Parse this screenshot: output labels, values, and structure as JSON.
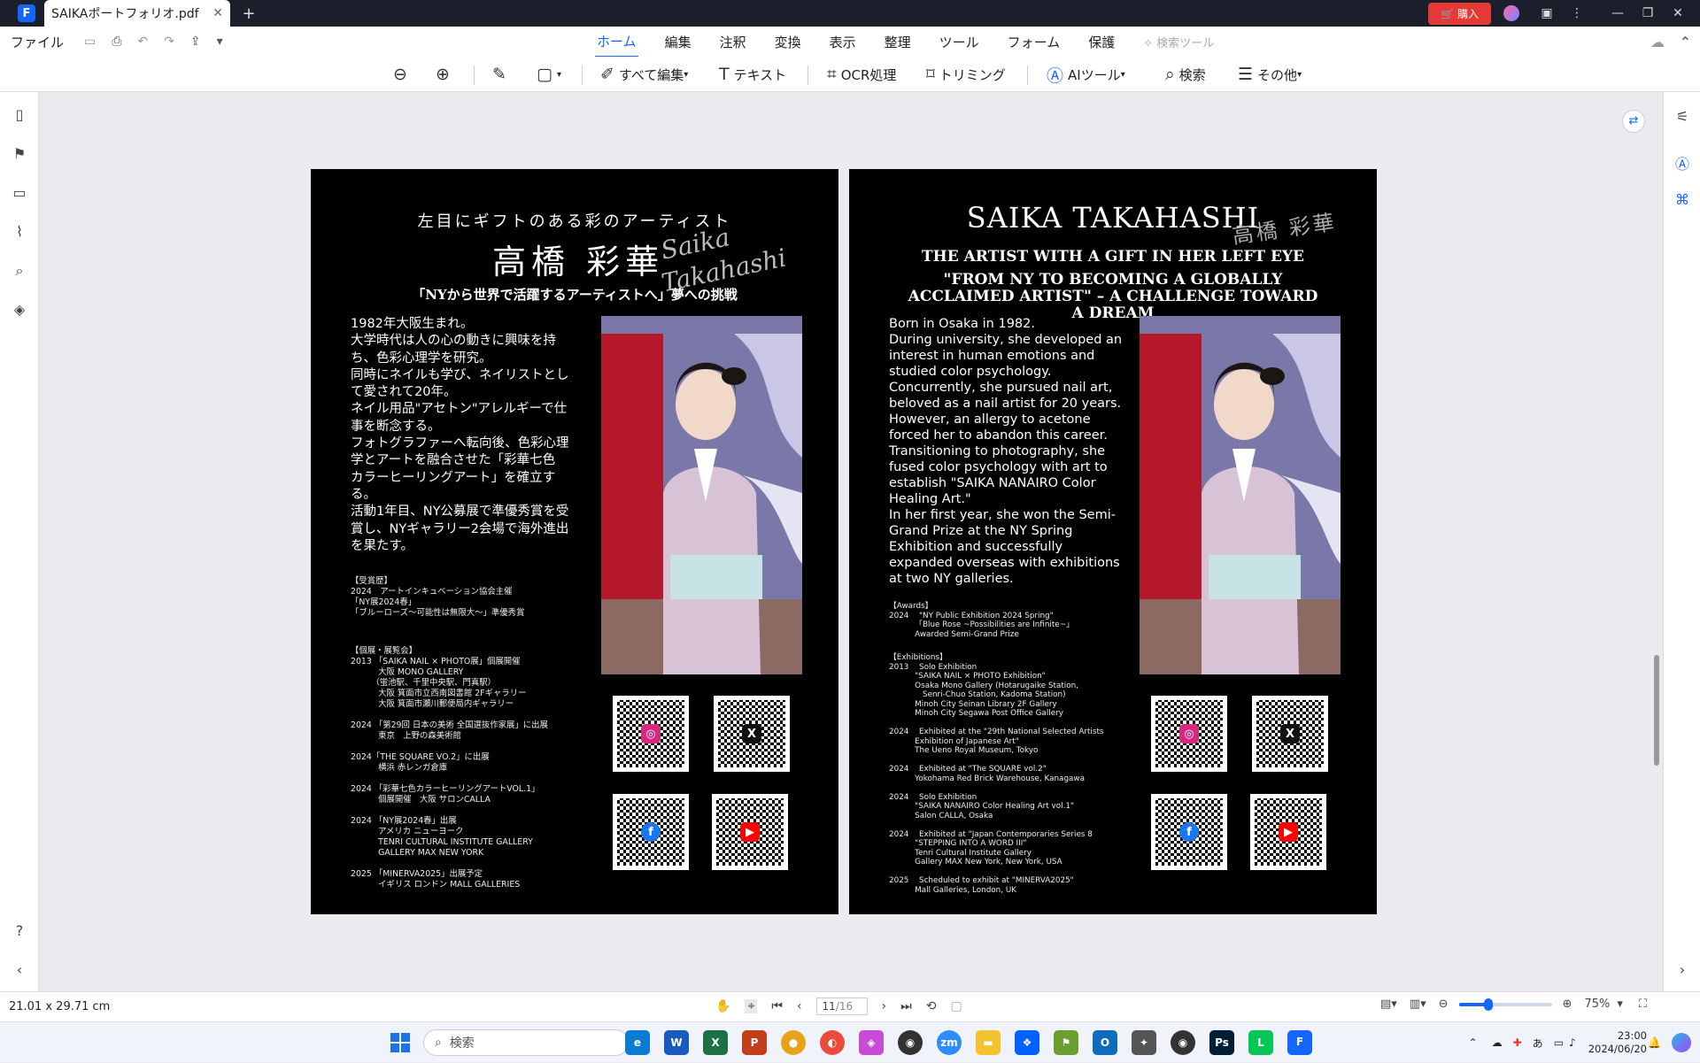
{
  "titlebar": {
    "logo": "F",
    "tab_title": "SAIKAポートフォリオ.pdf",
    "close": "✕",
    "new_tab": "+",
    "buy_label": "購入"
  },
  "menubar": {
    "file": "ファイル",
    "menus": [
      "ホーム",
      "編集",
      "注釈",
      "変換",
      "表示",
      "整理",
      "ツール",
      "フォーム",
      "保護"
    ],
    "search_tools": "検索ツール"
  },
  "toolbar": {
    "edit_all": "すべて編集",
    "text": "テキスト",
    "ocr": "OCR処理",
    "trim": "トリミング",
    "ai_tools": "AIツール",
    "search": "検索",
    "more": "その他"
  },
  "page_left": {
    "headline": "左目にギフトのある彩のアーティスト",
    "name": "高橋 彩華",
    "script_sign_1": "Saika",
    "script_sign_2": "Takahashi",
    "tagline": "「NYから世界で活躍するアーティストへ」夢への挑戦",
    "bio": "1982年大阪生まれ。\n大学時代は人の心の動きに興味を持ち、色彩心理学を研究。\n同時にネイルも学び、ネイリストとして愛されて20年。\nネイル用品\"アセトン\"アレルギーで仕事を断念する。\nフォトグラファーへ転向後、色彩心理学とアートを融合させた「彩華七色 カラーヒーリングアート」を確立する。\n活動1年目、NY公募展で準優秀賞を受賞し、NYギャラリー2会場で海外進出を果たす。",
    "awards": "【受賞歴】\n2024　アートインキュベーション協会主催\n「NY展2024春」\n「ブルーローズ〜可能性は無限大〜」準優秀賞",
    "exhibitions": "【個展・展覧会】\n2013 「SAIKA NAIL × PHOTO展」個展開催\n　　　 大阪 MONO GALLERY\n　　　（蛍池駅、千里中央駅、門真駅）\n　　　 大阪 箕面市立西南図書館 2Fギャラリー\n　　　 大阪 箕面市瀬川郵便局内ギャラリー\n\n2024 「第29回 日本の美術 全国選抜作家展」に出展\n　　　 東京　上野の森美術館\n\n2024「THE SQUARE VO.2」に出展\n　　　 横浜 赤レンガ倉庫\n\n2024 「彩華七色カラーヒーリングアートVOL.1」\n　　　 個展開催　大阪 サロンCALLA\n\n2024 「NY展2024春」出展\n　　　 アメリカ ニューヨーク\n　　　 TENRI CULTURAL INSTITUTE GALLERY\n　　　 GALLERY MAX NEW YORK\n\n2025 「MINERVA2025」出展予定\n　　　 イギリス ロンドン MALL GALLERIES"
  },
  "page_right": {
    "name": "SAIKA TAKAHASHI",
    "jp_sign": "高橋 彩華",
    "subtitle": "THE ARTIST WITH A GIFT IN HER LEFT EYE",
    "tagline": "\"FROM NY TO BECOMING A GLOBALLY ACCLAIMED ARTIST\" – A CHALLENGE TOWARD A DREAM",
    "bio": "Born in Osaka in 1982.\nDuring university, she developed an interest in human emotions and studied color psychology.\nConcurrently, she pursued nail art, beloved as a nail artist for 20 years.\nHowever, an allergy to acetone forced her to abandon this career.\nTransitioning to photography, she fused color psychology with art to establish \"SAIKA NANAIRO Color Healing Art.\"\nIn her first year, she won the Semi-Grand Prize at the NY Spring Exhibition and successfully expanded overseas with exhibitions at two NY galleries.",
    "awards": "【Awards】\n2024　 \"NY Public Exhibition 2024 Spring\"\n　　　 「Blue Rose ~Possibilities are Infinite~」\n　　　 Awarded Semi-Grand Prize",
    "exhibitions": "【Exhibitions】\n2013　 Solo Exhibition\n　　　 \"SAIKA NAIL × PHOTO Exhibition\"\n　　　 Osaka Mono Gallery (Hotarugaike Station,\n　　　 　Senri-Chuo Station, Kadoma Station)\n　　　 Minoh City Seinan Library 2F Gallery\n　　　 Minoh City Segawa Post Office Gallery\n\n2024　 Exhibited at the \"29th National Selected Artists\n　　　 Exhibition of Japanese Art\"\n　　　 The Ueno Royal Museum, Tokyo\n\n2024　 Exhibited at \"The SQUARE vol.2\"\n　　　 Yokohama Red Brick Warehouse, Kanagawa\n\n2024　 Solo Exhibition\n　　　 \"SAIKA NANAIRO Color Healing Art vol.1\"\n　　　 Salon CALLA, Osaka\n\n2024　 Exhibited at \"Japan Contemporaries Series 8\n　　　 \"STEPPING INTO A WORD III\"\n　　　 Tenri Cultural Institute Gallery\n　　　 Gallery MAX New York, New York, USA\n\n2025　 Scheduled to exhibit at \"MINERVA2025\"\n　　　 Mall Galleries, London, UK"
  },
  "qr_codes": [
    {
      "name": "instagram",
      "glyph": "◎",
      "color": "#d6297f"
    },
    {
      "name": "x",
      "glyph": "X",
      "color": "#111111"
    },
    {
      "name": "facebook",
      "glyph": "f",
      "color": "#1877f2"
    },
    {
      "name": "youtube",
      "glyph": "▶",
      "color": "#ff0000"
    }
  ],
  "statusbar": {
    "page_size": "21.01 x 29.71 cm",
    "current_page": "11",
    "total_pages": "/16",
    "zoom_percent": "75%",
    "zoom_level": 0.32
  },
  "taskbar": {
    "search_placeholder": "検索",
    "time": "23:00",
    "date": "2024/06/20",
    "ime": "あ"
  }
}
